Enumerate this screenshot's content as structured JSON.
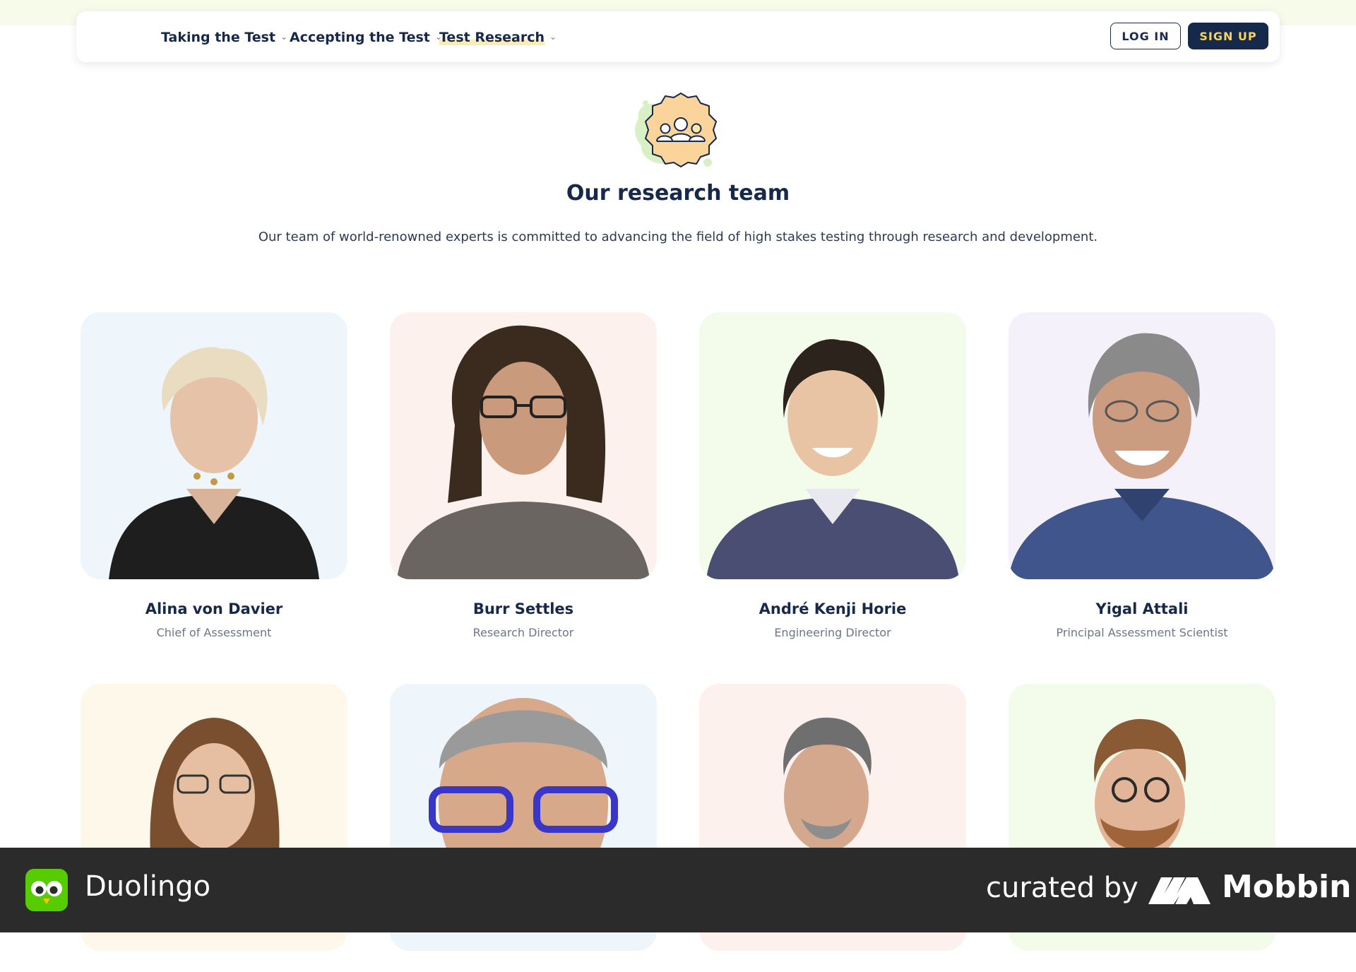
{
  "nav": {
    "items": [
      {
        "label": "Taking the Test"
      },
      {
        "label": "Accepting the Test"
      },
      {
        "label": "Test Research"
      }
    ],
    "login_label": "LOG IN",
    "signup_label": "SIGN UP"
  },
  "hero": {
    "icon": "team-badge-icon",
    "title": "Our research team",
    "description": "Our team of world-renowned experts is committed to advancing the field of high stakes testing through research and development."
  },
  "team": [
    {
      "name": "Alina von Davier",
      "role": "Chief of Assessment",
      "bg": "#eef6fb"
    },
    {
      "name": "Burr Settles",
      "role": "Research Director",
      "bg": "#fdf1ee"
    },
    {
      "name": "André Kenji Horie",
      "role": "Engineering Director",
      "bg": "#f3fbea"
    },
    {
      "name": "Yigal Attali",
      "role": "Principal Assessment Scientist",
      "bg": "#f5f1fb"
    },
    {
      "name": "",
      "role": "",
      "bg": "#fdf8ea"
    },
    {
      "name": "",
      "role": "",
      "bg": "#eef6fb"
    },
    {
      "name": "",
      "role": "",
      "bg": "#fdf1ee"
    },
    {
      "name": "",
      "role": "",
      "bg": "#f3fbea"
    }
  ],
  "footer": {
    "app_name": "Duolingo",
    "curated_by": "curated by",
    "brand": "Mobbin"
  },
  "colors": {
    "navy": "#17294a",
    "accent_yellow": "#f7d35a",
    "footer_bg": "#2b2b2b",
    "duolingo_green": "#58cc02"
  }
}
